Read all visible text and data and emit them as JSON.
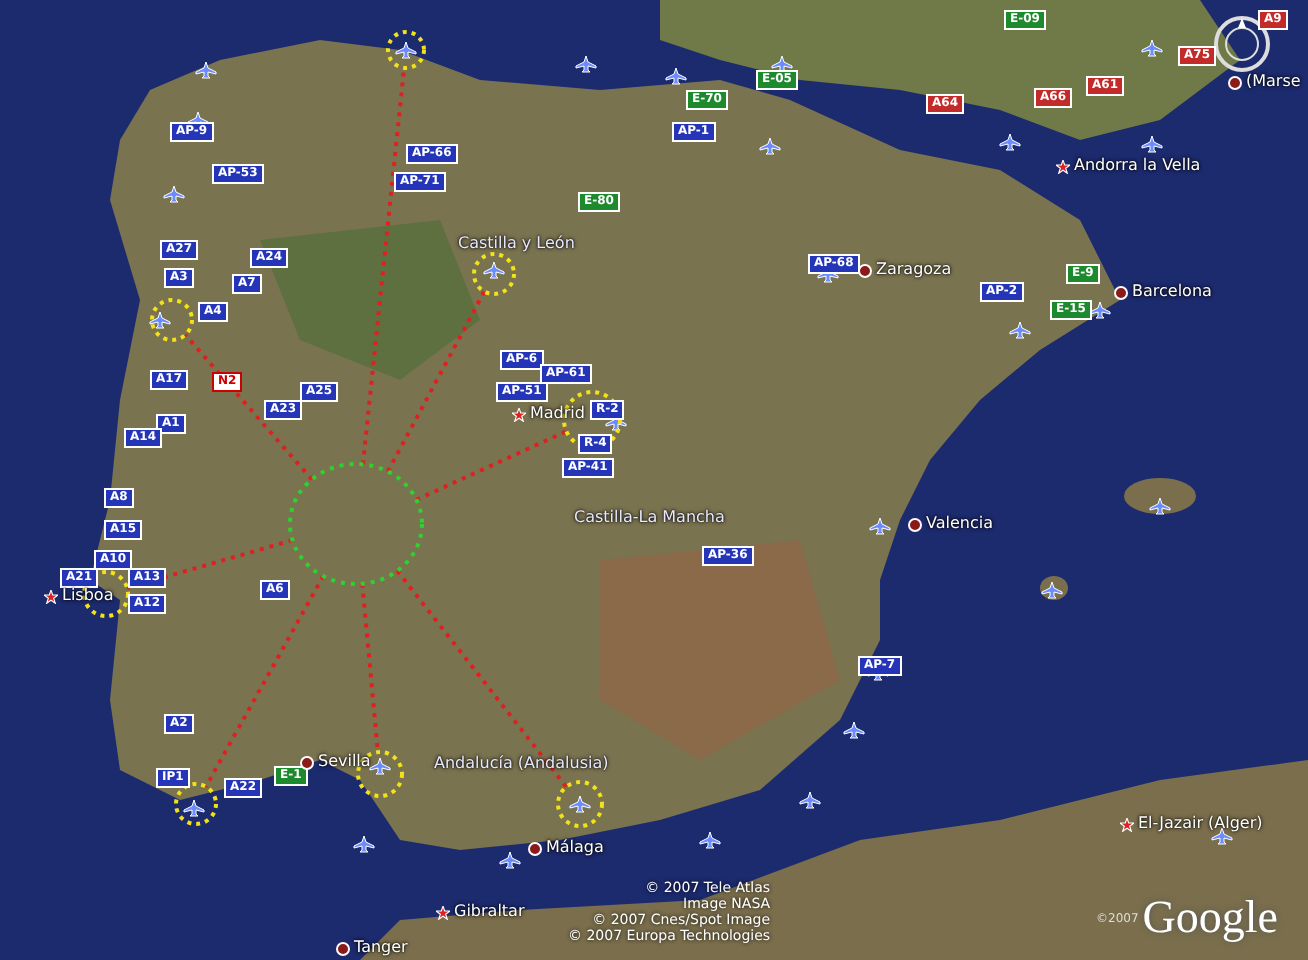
{
  "map": {
    "place_labels": [
      {
        "text": "Castilla y León",
        "kind": "region"
      },
      {
        "text": "Madrid",
        "kind": "capital"
      },
      {
        "text": "Castilla-La Mancha",
        "kind": "region"
      },
      {
        "text": "Zaragoza",
        "kind": "city"
      },
      {
        "text": "Andorra la Vella",
        "kind": "capital"
      },
      {
        "text": "Barcelona",
        "kind": "city"
      },
      {
        "text": "Valencia",
        "kind": "city"
      },
      {
        "text": "Sevilla",
        "kind": "city"
      },
      {
        "text": "Andalucía (Andalusia)",
        "kind": "region"
      },
      {
        "text": "Lisboa",
        "kind": "capital"
      },
      {
        "text": "Málaga",
        "kind": "city"
      },
      {
        "text": "Gibraltar",
        "kind": "capital"
      },
      {
        "text": "Tanger",
        "kind": "city"
      },
      {
        "text": "El-Jazair (Alger)",
        "kind": "capital"
      },
      {
        "text": "(Marse",
        "kind": "city"
      }
    ],
    "road_shields": [
      {
        "label": "AP-9",
        "kind": "motorway"
      },
      {
        "label": "AP-53",
        "kind": "motorway"
      },
      {
        "label": "AP-66",
        "kind": "motorway"
      },
      {
        "label": "AP-71",
        "kind": "motorway"
      },
      {
        "label": "A27",
        "kind": "motorway"
      },
      {
        "label": "A3",
        "kind": "motorway"
      },
      {
        "label": "A24",
        "kind": "motorway"
      },
      {
        "label": "A7",
        "kind": "motorway"
      },
      {
        "label": "A4",
        "kind": "motorway"
      },
      {
        "label": "A17",
        "kind": "motorway"
      },
      {
        "label": "A25",
        "kind": "motorway"
      },
      {
        "label": "A23",
        "kind": "motorway"
      },
      {
        "label": "A1",
        "kind": "motorway"
      },
      {
        "label": "A14",
        "kind": "motorway"
      },
      {
        "label": "AP-6",
        "kind": "motorway"
      },
      {
        "label": "AP-61",
        "kind": "motorway"
      },
      {
        "label": "AP-51",
        "kind": "motorway"
      },
      {
        "label": "R-2",
        "kind": "motorway"
      },
      {
        "label": "R-4",
        "kind": "motorway"
      },
      {
        "label": "AP-41",
        "kind": "motorway"
      },
      {
        "label": "E-80",
        "kind": "european"
      },
      {
        "label": "N2",
        "kind": "national"
      },
      {
        "label": "E-09",
        "kind": "european"
      },
      {
        "label": "A9",
        "kind": "french"
      },
      {
        "label": "A64",
        "kind": "french"
      },
      {
        "label": "A66",
        "kind": "french"
      },
      {
        "label": "A61",
        "kind": "french"
      },
      {
        "label": "A75",
        "kind": "french"
      },
      {
        "label": "E-70",
        "kind": "european"
      },
      {
        "label": "E-05",
        "kind": "european"
      },
      {
        "label": "AP-1",
        "kind": "motorway"
      },
      {
        "label": "AP-68",
        "kind": "motorway"
      },
      {
        "label": "AP-2",
        "kind": "motorway"
      },
      {
        "label": "E-9",
        "kind": "european"
      },
      {
        "label": "E-15",
        "kind": "european"
      },
      {
        "label": "A8",
        "kind": "motorway"
      },
      {
        "label": "A15",
        "kind": "motorway"
      },
      {
        "label": "A21",
        "kind": "motorway"
      },
      {
        "label": "A10",
        "kind": "motorway"
      },
      {
        "label": "A13",
        "kind": "motorway"
      },
      {
        "label": "A12",
        "kind": "motorway"
      },
      {
        "label": "A6",
        "kind": "motorway"
      },
      {
        "label": "A2",
        "kind": "motorway"
      },
      {
        "label": "IP1",
        "kind": "motorway"
      },
      {
        "label": "A22",
        "kind": "motorway"
      },
      {
        "label": "E-1",
        "kind": "european"
      },
      {
        "label": "AP-36",
        "kind": "motorway"
      },
      {
        "label": "AP-7",
        "kind": "motorway"
      }
    ],
    "attribution": [
      "© 2007 Tele Atlas",
      "Image NASA",
      "© 2007 Cnes/Spot Image",
      "© 2007 Europa Technologies"
    ],
    "logo": {
      "copyright": "©2007",
      "text": "Google"
    }
  }
}
